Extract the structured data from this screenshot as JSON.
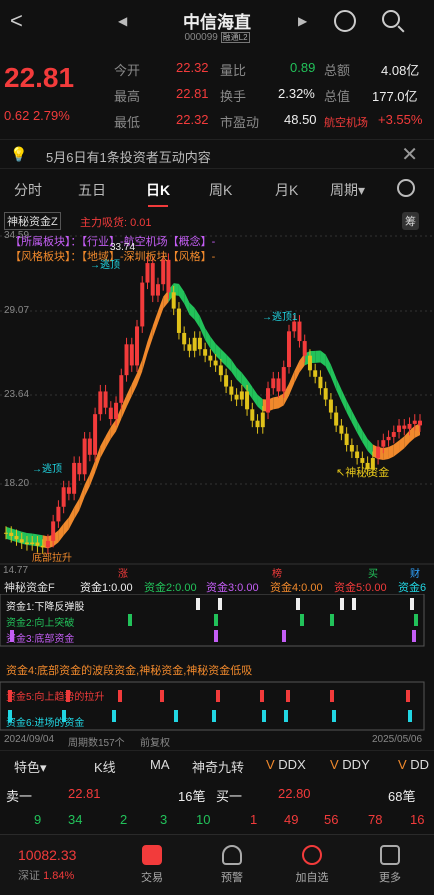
{
  "header": {
    "title": "中信海直",
    "code": "000099",
    "tag": "融通L2"
  },
  "quote": {
    "price": "22.81",
    "change": "0.62",
    "change_pct": "2.79%",
    "cells": [
      {
        "label": "今开",
        "value": "22.32",
        "label2": "量比",
        "value2": "0.89",
        "label3": "总额",
        "value3": "4.08亿"
      },
      {
        "label": "最高",
        "value": "22.81",
        "label2": "换手",
        "value2": "2.32%",
        "label3": "总值",
        "value3": "177.0亿"
      },
      {
        "label": "最低",
        "value": "22.32",
        "label2": "市盈动",
        "value2": "48.50",
        "label3": "航空机场",
        "value3": "+3.55%"
      }
    ]
  },
  "notice": {
    "text": "5月6日有1条投资者互动内容"
  },
  "tabs": [
    "分时",
    "五日",
    "日K",
    "周K",
    "月K",
    "周期▾"
  ],
  "indicator": {
    "name": "神秘资金Z",
    "flow": "主力吸货: 0.01",
    "tag": "筹"
  },
  "main_labels": {
    "industry": "【所属板块】：【行业】-航空机场【概念】-",
    "style": "【风格板块】：【地域】-深圳板块【风格】-",
    "price_marks": [
      "34.59",
      "29.07",
      "23.64",
      "18.20"
    ],
    "peak": "33.74",
    "notes": [
      "→逃顶",
      "→逃顶1",
      "→逃顶",
      "底部拉升",
      "↖神秘资金"
    ],
    "bottom_low": "14.77",
    "bottom_tags": [
      "解",
      "涨",
      "榜",
      "买",
      "财"
    ]
  },
  "sub": {
    "name": "神秘资金F",
    "legend": [
      "资金1:0.00",
      "资金2:0.00",
      "资金3:0.00",
      "资金4:0.00",
      "资金5:0.00",
      "资金6"
    ],
    "rows": [
      "资金1:下降反弹股",
      "资金2:向上突破",
      "资金3:底部资金",
      "资金4:底部资金的波段资金,神秘资金,神秘资金低吸",
      "资金5:向上趋势的拉升",
      "资金6:进场的资金"
    ],
    "date_start": "2024/09/04",
    "period": "周期数157个",
    "fq": "前复权",
    "date_end": "2025/05/06"
  },
  "toolbar": [
    "特色▾",
    "K线",
    "MA",
    "神奇九转",
    "DDX",
    "DDY",
    "DD"
  ],
  "book": {
    "sell_label": "卖一",
    "sell_price": "22.81",
    "sell_vol": "16笔",
    "buy_label": "买一",
    "buy_price": "22.80",
    "buy_vol": "68笔",
    "ticks": [
      "9",
      "34",
      "2",
      "3",
      "10",
      "1",
      "49",
      "56",
      "78",
      "16"
    ]
  },
  "nav": {
    "index_value": "10082.33",
    "index_name": "深证",
    "index_pct": "1.84%",
    "items": [
      "交易",
      "预警",
      "加自选",
      "更多"
    ]
  },
  "chart_data": {
    "type": "candlestick",
    "ylabels": [
      "34.59",
      "29.07",
      "23.64",
      "18.20"
    ],
    "closes": [
      16.2,
      16.0,
      15.8,
      15.6,
      15.5,
      15.6,
      15.4,
      15.3,
      15.7,
      16.9,
      17.8,
      19.0,
      18.6,
      20.5,
      19.8,
      22.0,
      21.0,
      23.5,
      24.9,
      23.9,
      23.2,
      24.2,
      25.9,
      27.8,
      26.5,
      28.9,
      31.6,
      32.8,
      30.8,
      31.5,
      33.0,
      31.0,
      30.0,
      28.5,
      27.8,
      27.4,
      28.2,
      27.5,
      27.1,
      26.8,
      26.5,
      25.9,
      25.2,
      24.7,
      24.4,
      24.9,
      23.8,
      23.1,
      22.7,
      23.6,
      25.1,
      25.7,
      24.9,
      26.4,
      28.6,
      29.2,
      28.0,
      27.1,
      26.2,
      25.8,
      25.1,
      24.4,
      23.6,
      22.8,
      22.3,
      21.6,
      21.2,
      20.8,
      20.5,
      20.1,
      20.8,
      21.5,
      21.9,
      22.1,
      22.4,
      22.8,
      22.6,
      22.9,
      23.1,
      22.81
    ]
  }
}
